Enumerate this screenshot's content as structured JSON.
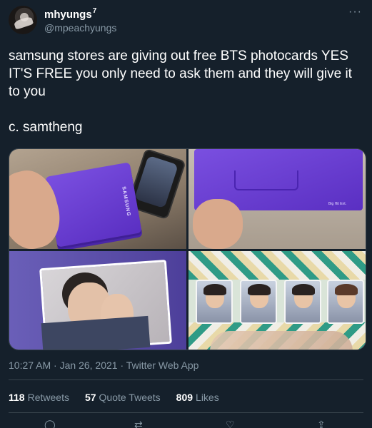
{
  "user": {
    "name": "mhyungs",
    "badge": "7",
    "handle": "@mpeachyungs"
  },
  "menu_icon": "more-horizontal-icon",
  "tweet": {
    "text": "samsung stores are giving out free BTS photocards YES IT'S FREE you only need to ask them and they will give it to you\n\nc. samtheng"
  },
  "media_labels": {
    "box_brand": "SAMSUNG",
    "envelope_brand": "Big Hit Ent."
  },
  "meta": {
    "time": "10:27 AM",
    "date": "Jan 26, 2021",
    "sep": "·",
    "source": "Twitter Web App"
  },
  "stats": {
    "retweets_count": "118",
    "retweets_label": "Retweets",
    "quotes_count": "57",
    "quotes_label": "Quote Tweets",
    "likes_count": "809",
    "likes_label": "Likes"
  },
  "action_icons": [
    "reply-icon",
    "retweet-icon",
    "like-icon",
    "share-icon"
  ],
  "colors": {
    "background": "#15202b",
    "text": "#ffffff",
    "secondary": "#8899a6",
    "border": "#38444d",
    "accent_purple": "#6a3fd6"
  }
}
